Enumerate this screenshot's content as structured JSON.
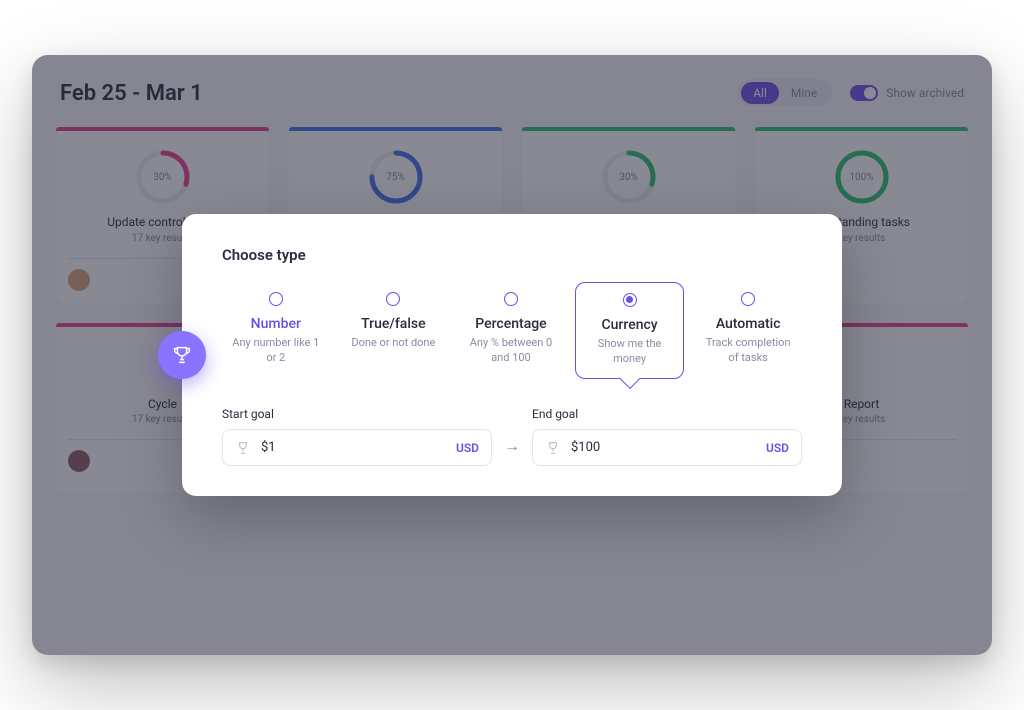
{
  "header": {
    "date_range": "Feb 25 - Mar 1",
    "filter_all": "All",
    "filter_mine": "Mine",
    "show_archived": "Show archived"
  },
  "cards": [
    {
      "color": "#e83f8e",
      "pct": "30%",
      "title": "Update control panel",
      "sub": "17 key results"
    },
    {
      "color": "#3f6fe8",
      "pct": "75%",
      "title": "",
      "sub": ""
    },
    {
      "color": "#27c26c",
      "pct": "30%",
      "title": "",
      "sub": ""
    },
    {
      "color": "#27c26c",
      "pct": "100%",
      "title": "Outstanding tasks",
      "sub": "key results"
    },
    {
      "color": "#e83f8e",
      "pct": "",
      "title": "Cycle",
      "sub": "17 key results"
    },
    {
      "color": "#f09a2a",
      "pct": "",
      "title": "",
      "sub": ""
    },
    {
      "color": "#f0c92a",
      "pct": "",
      "title": "",
      "sub": ""
    },
    {
      "color": "#e83f8e",
      "pct": "",
      "title": "Report",
      "sub": "key results"
    }
  ],
  "modal": {
    "heading": "Choose type",
    "types": [
      {
        "name": "Number",
        "desc": "Any number like 1 or 2"
      },
      {
        "name": "True/false",
        "desc": "Done or not done"
      },
      {
        "name": "Percentage",
        "desc": "Any % between 0 and 100"
      },
      {
        "name": "Currency",
        "desc": "Show me the money"
      },
      {
        "name": "Automatic",
        "desc": "Track completion of tasks"
      }
    ],
    "start_label": "Start goal",
    "start_value": "$1",
    "end_label": "End goal",
    "end_value": "$100",
    "unit": "USD"
  }
}
